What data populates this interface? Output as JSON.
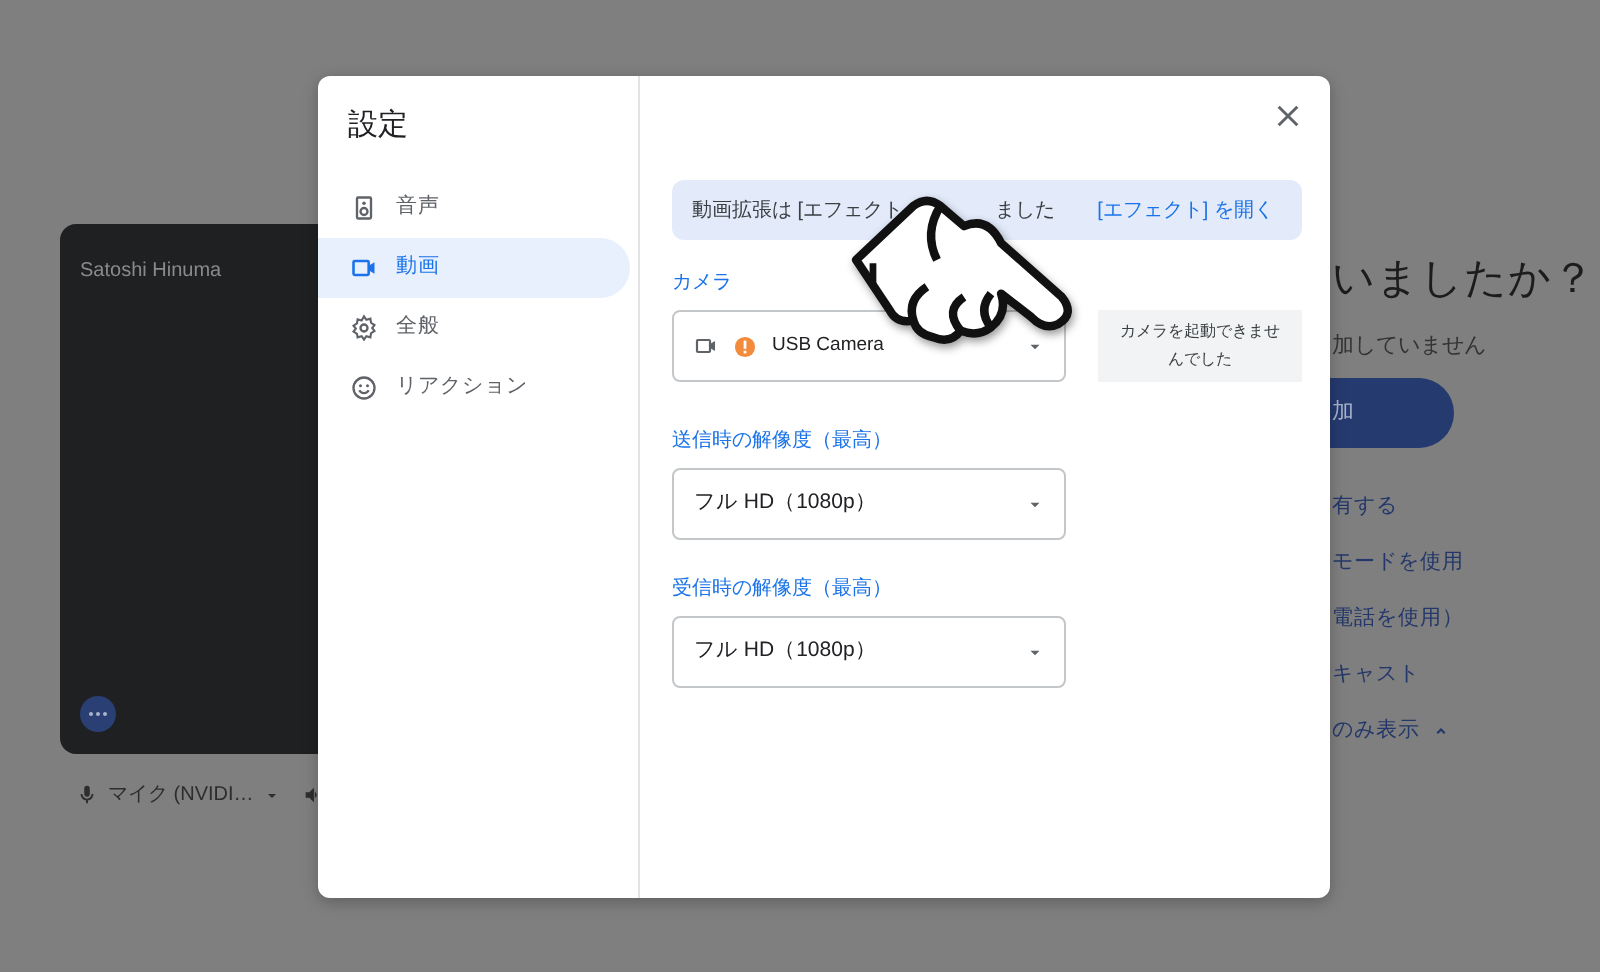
{
  "background": {
    "tile_name": "Satoshi Hinuma",
    "mic_label": "マイク (NVIDI…",
    "heading": "いましたか？",
    "subtext": "加していません",
    "join_button": "加",
    "links": [
      {
        "label": "有する"
      },
      {
        "label": "モードを使用"
      },
      {
        "label": "電話を使用）"
      },
      {
        "label": "キャスト"
      },
      {
        "label": "のみ表示",
        "expanded": true
      }
    ]
  },
  "dialog": {
    "title": "設定",
    "nav": [
      {
        "label": "音声",
        "kind": "audio",
        "selected": false
      },
      {
        "label": "動画",
        "kind": "video",
        "selected": true
      },
      {
        "label": "全般",
        "kind": "general",
        "selected": false
      },
      {
        "label": "リアクション",
        "kind": "reactions",
        "selected": false
      }
    ],
    "banner": {
      "text_parts": [
        "動画拡張は [エフェクト",
        "ました"
      ],
      "link": "[エフェクト] を開く"
    },
    "camera": {
      "label": "カメラ",
      "value": "USB Camera",
      "warning": true,
      "error_message": "カメラを起動できませんでした"
    },
    "send_resolution": {
      "label": "送信時の解像度（最高）",
      "value": "フル HD（1080p）"
    },
    "receive_resolution": {
      "label": "受信時の解像度（最高）",
      "value": "フル HD（1080p）"
    }
  }
}
